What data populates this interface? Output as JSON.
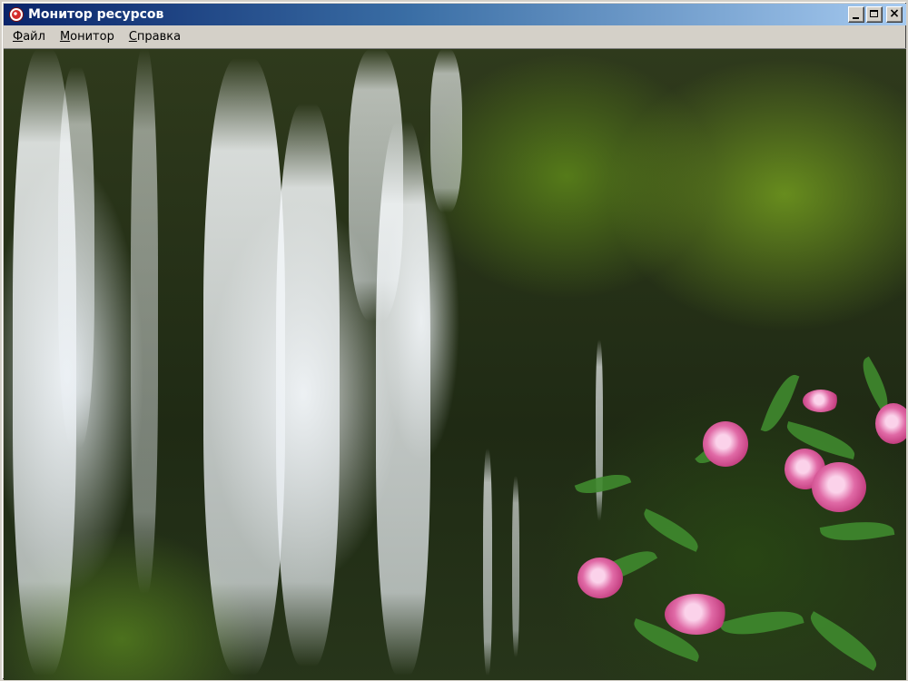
{
  "window": {
    "title": "Монитор ресурсов",
    "buttons": {
      "minimize_icon": "minimize-icon",
      "maximize_icon": "maximize-icon",
      "close_icon": "close-icon",
      "close_glyph": "×"
    }
  },
  "menu": {
    "items": [
      {
        "accel": "Ф",
        "rest": "айл"
      },
      {
        "accel": "М",
        "rest": "онитор"
      },
      {
        "accel": "С",
        "rest": "правка"
      }
    ]
  },
  "content": {
    "image": "waterfall-photo"
  },
  "colors": {
    "titlebar_start": "#0a246a",
    "titlebar_end": "#a6caf0",
    "chrome": "#d4d0c8"
  }
}
